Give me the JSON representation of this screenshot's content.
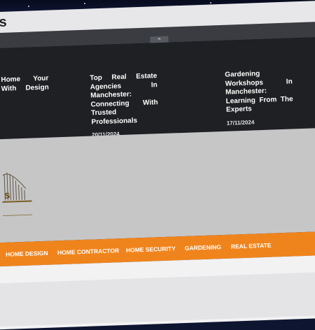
{
  "site": {
    "title_fragment": "s",
    "logo_letter": "s"
  },
  "toggle": {
    "label": "⌃"
  },
  "news": [
    {
      "title": "Home Your With Design",
      "date": ""
    },
    {
      "title": "Top Real Estate Agencies In Manchester: Connecting With Trusted Professionals",
      "date": "20/11/2024"
    },
    {
      "title": "Gardening Workshops In Manchester: Learning From The Experts",
      "date": "17/11/2024"
    }
  ],
  "nav": {
    "items": [
      "HOME DESIGN",
      "HOME CONTRACTOR",
      "HOME SECURITY",
      "GARDENING",
      "REAL ESTATE"
    ]
  },
  "colors": {
    "accent": "#f0841c",
    "dark_panel": "#1f2023",
    "hero_bg": "#c6c6c6"
  }
}
